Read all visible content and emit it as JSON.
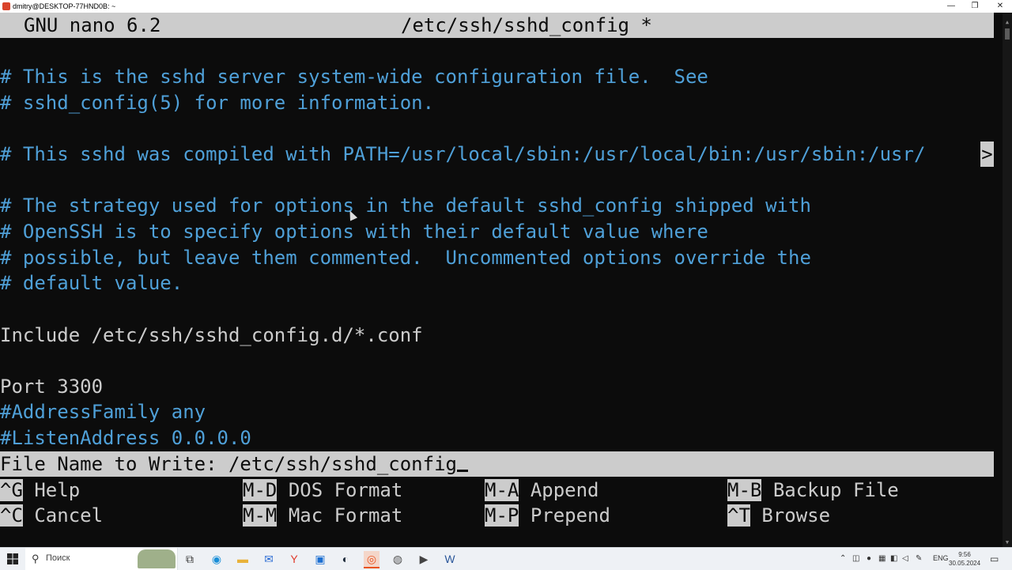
{
  "window": {
    "title": "dmitry@DESKTOP-77HND0B: ~",
    "minimize_glyph": "—",
    "maximize_glyph": "❐",
    "close_glyph": "✕"
  },
  "nano": {
    "version": "GNU nano 6.2",
    "filename": "/etc/ssh/sshd_config *",
    "overflow_marker": ">",
    "lines": [
      {
        "text": "# This is the sshd server system-wide configuration file.  See",
        "kind": "comment"
      },
      {
        "text": "# sshd_config(5) for more information.",
        "kind": "comment"
      },
      {
        "text": "",
        "kind": "blank"
      },
      {
        "text": "# This sshd was compiled with PATH=/usr/local/sbin:/usr/local/bin:/usr/sbin:/usr/",
        "kind": "comment"
      },
      {
        "text": "",
        "kind": "blank"
      },
      {
        "text": "# The strategy used for options in the default sshd_config shipped with",
        "kind": "comment"
      },
      {
        "text": "# OpenSSH is to specify options with their default value where",
        "kind": "comment"
      },
      {
        "text": "# possible, but leave them commented.  Uncommented options override the",
        "kind": "comment"
      },
      {
        "text": "# default value.",
        "kind": "comment"
      },
      {
        "text": "",
        "kind": "blank"
      },
      {
        "text": "Include /etc/ssh/sshd_config.d/*.conf",
        "kind": "normal"
      },
      {
        "text": "",
        "kind": "blank"
      },
      {
        "text": "Port 3300",
        "kind": "normal"
      },
      {
        "text": "#AddressFamily any",
        "kind": "comment"
      },
      {
        "text": "#ListenAddress 0.0.0.0",
        "kind": "comment"
      }
    ],
    "prompt": {
      "label": "File Name to Write: ",
      "value": "/etc/ssh/sshd_config"
    },
    "shortcuts": [
      {
        "key": "^G",
        "label": "Help"
      },
      {
        "key": "M-D",
        "label": "DOS Format"
      },
      {
        "key": "M-A",
        "label": "Append"
      },
      {
        "key": "M-B",
        "label": "Backup File"
      },
      {
        "key": "^C",
        "label": "Cancel"
      },
      {
        "key": "M-M",
        "label": "Mac Format"
      },
      {
        "key": "M-P",
        "label": "Prepend"
      },
      {
        "key": "^T",
        "label": "Browse"
      }
    ]
  },
  "taskbar": {
    "start_icon": "windows-start-icon",
    "search_placeholder": "Поиск",
    "pinned": [
      {
        "name": "task-view-icon",
        "glyph": "⧉",
        "color": "#333333"
      },
      {
        "name": "edge-icon",
        "glyph": "◉",
        "color": "#1a8fd8"
      },
      {
        "name": "file-explorer-icon",
        "glyph": "▬",
        "color": "#e8b23a"
      },
      {
        "name": "mail-icon",
        "glyph": "✉",
        "color": "#2b6cd4"
      },
      {
        "name": "yandex-browser-icon",
        "glyph": "Y",
        "color": "#e03a2b"
      },
      {
        "name": "store-icon",
        "glyph": "▣",
        "color": "#1c6fd1"
      },
      {
        "name": "steam-icon",
        "glyph": "◐",
        "color": "#1b2838"
      },
      {
        "name": "ubuntu-terminal-icon",
        "glyph": "◎",
        "color": "#e95420"
      },
      {
        "name": "chrome-debug-icon",
        "glyph": "◍",
        "color": "#555555"
      },
      {
        "name": "media-player-icon",
        "glyph": "▶",
        "color": "#444444"
      },
      {
        "name": "word-icon",
        "glyph": "W",
        "color": "#2b579a"
      }
    ],
    "language": "ENG",
    "time": "9:56",
    "date": "30.05.2024"
  }
}
